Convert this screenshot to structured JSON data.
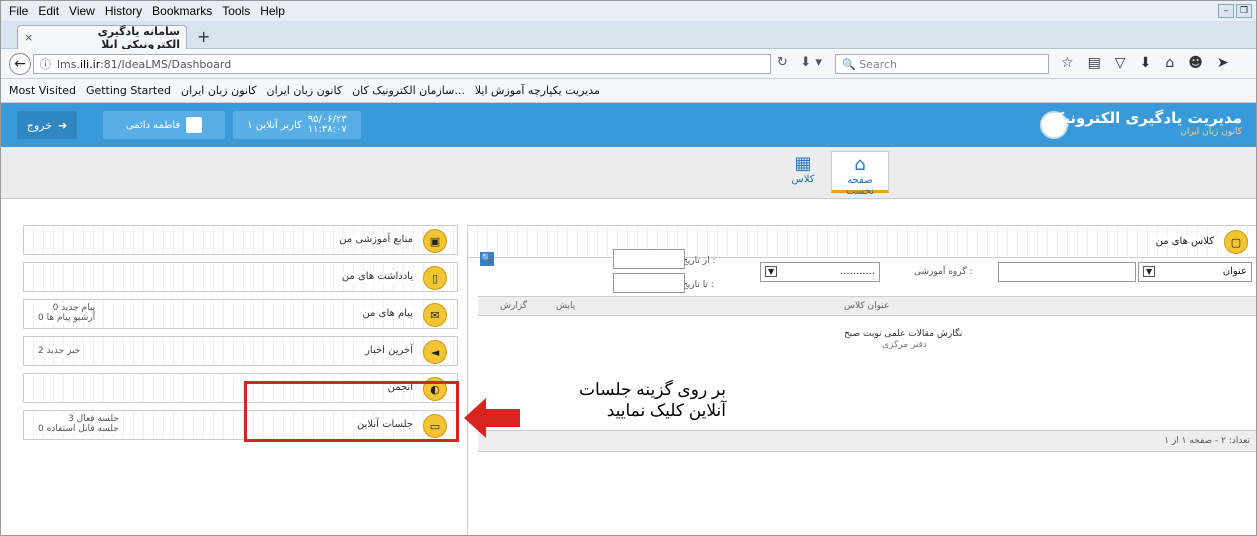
{
  "menubar": {
    "items": [
      "File",
      "Edit",
      "View",
      "History",
      "Bookmarks",
      "Tools",
      "Help"
    ]
  },
  "browser_tab": {
    "title": "سامانه یادگیری الکترونیکی ایلا",
    "close": "×",
    "new_tab": "+"
  },
  "navbar": {
    "url_prefix": "lms.",
    "url_domain": "ili.ir",
    "url_rest": ":81/IdeaLMS/Dashboard",
    "search_placeholder": "Search"
  },
  "bookmarks": {
    "items": [
      "Most Visited",
      "Getting Started",
      "کانون زبان ایران",
      "کانون زبان ایران",
      "سازمان الکترونیک کان...",
      "مدیریت یکپارچه آموزش ایلا"
    ]
  },
  "header": {
    "brand_title": "مدیریت یادگیری الکترونیکی",
    "brand_sub": "کانون زبان ایران",
    "date": "۹۵/۰۶/۲۳",
    "time": "۱۱:۳۸:۰۷",
    "online_users": "۱ کاربر آنلاین",
    "user_name": "فاطمه دائمی",
    "exit": "خروج"
  },
  "topnav": {
    "home": "صفحه نخست",
    "class": "کلاس"
  },
  "left_panels": [
    {
      "label": "منابع آموزشی من",
      "sub1": "",
      "sub2": ""
    },
    {
      "label": "یادداشت های من",
      "sub1": "",
      "sub2": ""
    },
    {
      "label": "پیام های من",
      "sub1": "پیام جدید 0",
      "sub2": "آرشیو پیام ها 0"
    },
    {
      "label": "آخرین اخبار",
      "sub1": "خبر جدید 2",
      "sub2": ""
    },
    {
      "label": "انجمن",
      "sub1": "",
      "sub2": ""
    },
    {
      "label": "جلسات آنلاین",
      "sub1": "جلسه فعال 3",
      "sub2": "جلسه قابل استفاده 0"
    }
  ],
  "classes": {
    "title": "کلاس های من",
    "filter_title_select": "عنوان",
    "group_label": "گروه آموزشی :",
    "group_value": "...........",
    "from_label": "از تاریخ :",
    "to_label": "تا تاریخ :",
    "columns": {
      "title": "عنوان کلاس",
      "end": "پایش",
      "report": "گزارش"
    },
    "row_title": "نگارش مقالات علمی نوبت صبح",
    "row_sub": "دفتر مرکزی",
    "footer": "تعداد: ۲ - صفحه ۱ از ۱"
  },
  "annotation": {
    "line1": "بر روی گزینه جلسات",
    "line2": "آنلاین کلیک نمایید"
  },
  "colors": {
    "header": "#3a9ad9",
    "highlight": "#d9231f",
    "bubble": "#f2c532"
  }
}
